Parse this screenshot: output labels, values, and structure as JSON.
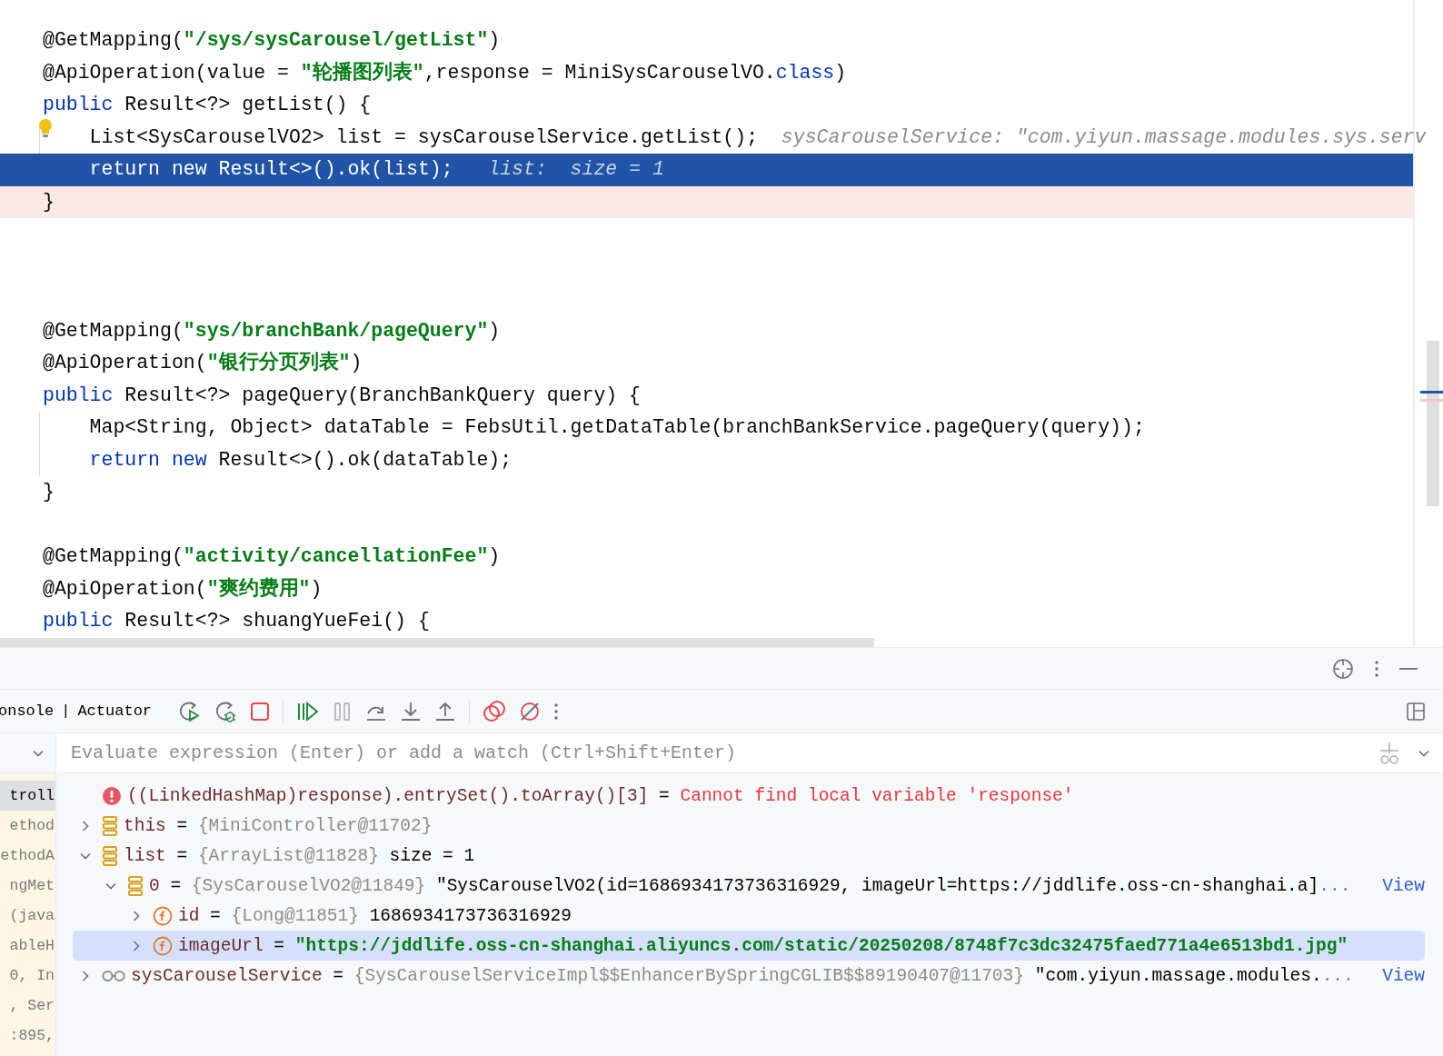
{
  "editor": {
    "lines": [
      {
        "kind": "code",
        "current": false,
        "breakpoint": false,
        "lightbulb": false,
        "tokens": [
          {
            "kind": "plain",
            "text": "@GetMapping("
          },
          {
            "kind": "string",
            "text": "\"/sys/sysCarousel/getList\""
          },
          {
            "kind": "plain",
            "text": ")"
          }
        ]
      },
      {
        "kind": "code",
        "current": false,
        "breakpoint": false,
        "lightbulb": false,
        "tokens": [
          {
            "kind": "plain",
            "text": "@ApiOperation(value = "
          },
          {
            "kind": "string",
            "text": "\"轮播图列表\""
          },
          {
            "kind": "plain",
            "text": ",response = MiniSysCarouselVO."
          },
          {
            "kind": "keyword",
            "text": "class"
          },
          {
            "kind": "plain",
            "text": ")"
          }
        ]
      },
      {
        "kind": "code",
        "current": false,
        "breakpoint": false,
        "lightbulb": false,
        "tokens": [
          {
            "kind": "keyword",
            "text": "public"
          },
          {
            "kind": "plain",
            "text": " Result<?> getList() {"
          }
        ]
      },
      {
        "kind": "code",
        "current": false,
        "breakpoint": false,
        "lightbulb": true,
        "tokens": [
          {
            "kind": "plain",
            "text": "    List<SysCarouselVO2> list = sysCarouselService.getList();"
          },
          {
            "kind": "hint",
            "text": "  sysCarouselService: \"com.yiyun.massage.modules.sys.serv"
          }
        ]
      },
      {
        "kind": "code",
        "current": true,
        "breakpoint": false,
        "lightbulb": false,
        "tokens": [
          {
            "kind": "keyword",
            "text": "    return new"
          },
          {
            "kind": "plain",
            "text": " Result<>().ok(list);"
          },
          {
            "kind": "hint",
            "text": "   list:  size = 1"
          }
        ]
      },
      {
        "kind": "code",
        "current": false,
        "breakpoint": true,
        "lightbulb": false,
        "tokens": [
          {
            "kind": "plain",
            "text": "}"
          }
        ]
      },
      {
        "kind": "blank"
      },
      {
        "kind": "blank"
      },
      {
        "kind": "blank"
      },
      {
        "kind": "code",
        "current": false,
        "breakpoint": false,
        "lightbulb": false,
        "tokens": [
          {
            "kind": "plain",
            "text": "@GetMapping("
          },
          {
            "kind": "string",
            "text": "\"sys/branchBank/pageQuery\""
          },
          {
            "kind": "plain",
            "text": ")"
          }
        ]
      },
      {
        "kind": "code",
        "current": false,
        "breakpoint": false,
        "lightbulb": false,
        "tokens": [
          {
            "kind": "plain",
            "text": "@ApiOperation("
          },
          {
            "kind": "string",
            "text": "\"银行分页列表\""
          },
          {
            "kind": "plain",
            "text": ")"
          }
        ]
      },
      {
        "kind": "code",
        "current": false,
        "breakpoint": false,
        "lightbulb": false,
        "tokens": [
          {
            "kind": "keyword",
            "text": "public"
          },
          {
            "kind": "plain",
            "text": " Result<?> pageQuery(BranchBankQuery query) {"
          }
        ]
      },
      {
        "kind": "code",
        "current": false,
        "breakpoint": false,
        "lightbulb": false,
        "tokens": [
          {
            "kind": "plain",
            "text": "    Map<String, Object> dataTable = FebsUtil.getDataTable(branchBankService.pageQuery(query));"
          }
        ]
      },
      {
        "kind": "code",
        "current": false,
        "breakpoint": false,
        "lightbulb": false,
        "tokens": [
          {
            "kind": "keyword",
            "text": "    return new"
          },
          {
            "kind": "plain",
            "text": " Result<>().ok(dataTable);"
          }
        ]
      },
      {
        "kind": "code",
        "current": false,
        "breakpoint": false,
        "lightbulb": false,
        "tokens": [
          {
            "kind": "plain",
            "text": "}"
          }
        ]
      },
      {
        "kind": "blank"
      },
      {
        "kind": "code",
        "current": false,
        "breakpoint": false,
        "lightbulb": false,
        "tokens": [
          {
            "kind": "plain",
            "text": "@GetMapping("
          },
          {
            "kind": "string",
            "text": "\"activity/cancellationFee\""
          },
          {
            "kind": "plain",
            "text": ")"
          }
        ]
      },
      {
        "kind": "code",
        "current": false,
        "breakpoint": false,
        "lightbulb": false,
        "tokens": [
          {
            "kind": "plain",
            "text": "@ApiOperation("
          },
          {
            "kind": "string",
            "text": "\"爽约费用\""
          },
          {
            "kind": "plain",
            "text": ")"
          }
        ]
      },
      {
        "kind": "code",
        "current": false,
        "breakpoint": false,
        "lightbulb": false,
        "tokens": [
          {
            "kind": "keyword",
            "text": "public"
          },
          {
            "kind": "plain",
            "text": " Result<?> shuangYueFei() {"
          }
        ]
      }
    ]
  },
  "debug_tabs": [
    {
      "label": "onsole"
    },
    {
      "label": "|"
    },
    {
      "label": "Actuator"
    }
  ],
  "evaluate": {
    "placeholder": "Evaluate expression (Enter) or add a watch (Ctrl+Shift+Enter)"
  },
  "frames": [
    {
      "text": "troll",
      "selected": true
    },
    {
      "text": "ethod",
      "selected": false
    },
    {
      "text": "ethodA",
      "selected": false
    },
    {
      "text": "ngMet",
      "selected": false
    },
    {
      "text": "(java",
      "selected": false
    },
    {
      "text": "ableH",
      "selected": false
    },
    {
      "text": "0, In",
      "selected": false
    },
    {
      "text": ", Ser",
      "selected": false
    },
    {
      "text": ":895,",
      "selected": false
    }
  ],
  "variables": [
    {
      "kind": "error",
      "name": "((LinkedHashMap)response).entrySet().toArray()[3]",
      "eq": "=",
      "error": "Cannot find local variable 'response'",
      "selected": false
    },
    {
      "kind": "object",
      "name": "this",
      "eq": "=",
      "type": "{MiniController@11702}",
      "expanded": false,
      "selected": false
    },
    {
      "kind": "object",
      "name": "list",
      "eq": "=",
      "type": "{ArrayList@11828}",
      "value": "size = 1",
      "expanded": true,
      "selected": false,
      "children": [
        {
          "kind": "object",
          "name": "0",
          "eq": "=",
          "type": "{SysCarouselVO2@11849}",
          "value": "\"SysCarouselVO2(id=1686934173736316929, imageUrl=https://jddlife.oss-cn-shanghai.a]",
          "more": "...",
          "link": "View",
          "expanded": true,
          "selected": false,
          "children": [
            {
              "kind": "field",
              "name": "id",
              "eq": "=",
              "type": "{Long@11851}",
              "value": "1686934173736316929",
              "expanded": false,
              "selected": false
            },
            {
              "kind": "field",
              "name": "imageUrl",
              "eq": "=",
              "string": "\"https://jddlife.oss-cn-shanghai.aliyuncs.com/static/20250208/8748f7c3dc32475faed771a4e6513bd1.jpg\"",
              "expanded": false,
              "selected": true
            }
          ]
        }
      ]
    },
    {
      "kind": "watch",
      "name": "sysCarouselService",
      "eq": "=",
      "type": "{SysCarouselServiceImpl$$EnhancerBySpringCGLIB$$89190407@11703}",
      "value": "\"com.yiyun.massage.modules.",
      "more": "...",
      "link": "View",
      "expanded": false,
      "selected": false
    }
  ]
}
